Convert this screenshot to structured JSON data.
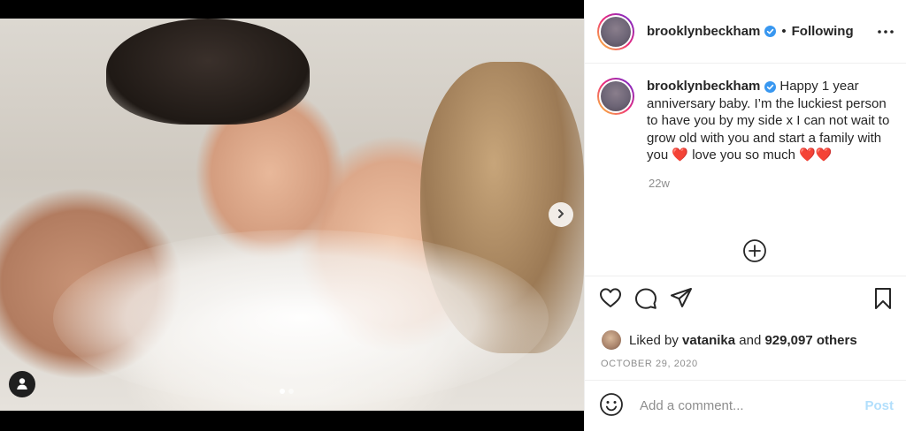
{
  "header": {
    "username": "brooklynbeckham",
    "separator": "•",
    "follow_status": "Following"
  },
  "caption": {
    "username": "brooklynbeckham",
    "text": "Happy 1 year anniversary baby. I’m the luckiest person to have you by my side x I can not wait to grow old with you and start a family with you ❤️ love you so much ❤️❤️",
    "time_ago": "22w"
  },
  "likes": {
    "prefix": "Liked by",
    "liker": "vatanika",
    "joiner": "and",
    "count": "929,097 others"
  },
  "post_date": "OCTOBER 29, 2020",
  "comment_box": {
    "placeholder": "Add a comment...",
    "post_label": "Post"
  },
  "carousel": {
    "slides": 2,
    "active": 1
  },
  "colors": {
    "verified_blue": "#3897f0",
    "post_disabled": "#b2dffc",
    "muted_text": "#8e8e8e"
  },
  "icons": {
    "header_more": "more-horizontal-icon",
    "next": "chevron-right-icon",
    "tagged_user": "user-tag-icon",
    "load_more": "plus-circle-icon",
    "like": "heart-icon",
    "comment": "comment-icon",
    "share": "paper-plane-icon",
    "save": "bookmark-icon",
    "emoji": "smiley-icon"
  }
}
